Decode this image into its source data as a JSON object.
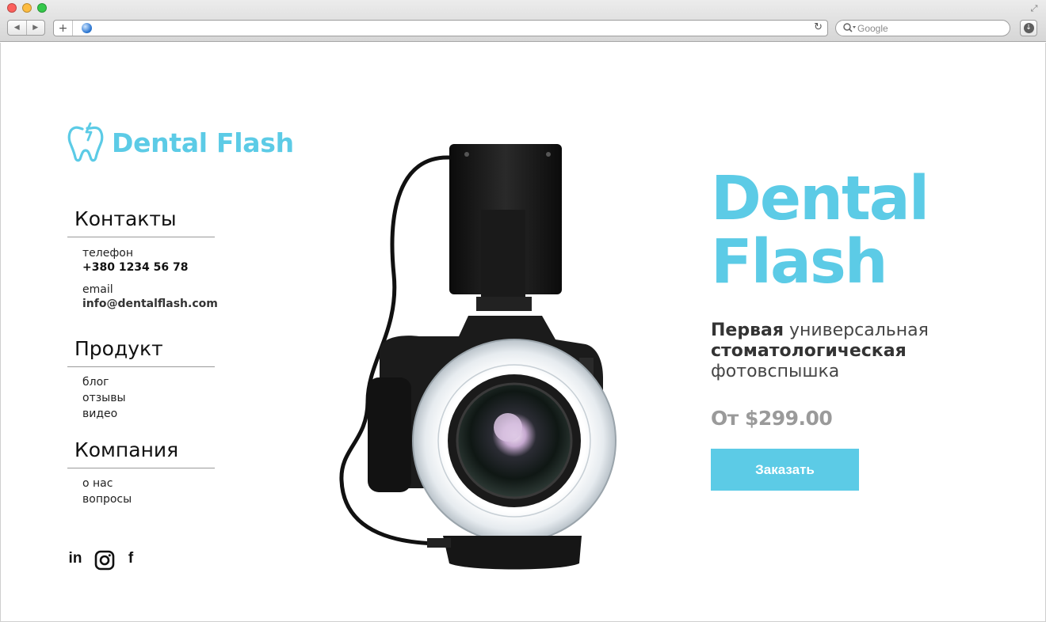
{
  "browser": {
    "search_placeholder": "Google",
    "icons": [
      "back-icon",
      "forward-icon",
      "new-tab-icon",
      "globe-icon",
      "reload-icon",
      "search-icon",
      "download-icon",
      "fullscreen-icon"
    ]
  },
  "brand": {
    "logo_text": "Dental Flash",
    "accent_color": "#5ccbe6"
  },
  "sidebar": {
    "contacts": {
      "title": "Контакты",
      "phone_label": "телефон",
      "phone_value": "+380 1234 56 78",
      "email_label": "email",
      "email_value": "info@dentalflash.com"
    },
    "product": {
      "title": "Продукт",
      "links": [
        "блог",
        "отзывы",
        "видео"
      ]
    },
    "company": {
      "title": "Компания",
      "links": [
        "о нас",
        "вопросы"
      ]
    },
    "social": {
      "linkedin": "in",
      "facebook": "f"
    }
  },
  "hero": {
    "title_line1": "Dental",
    "title_line2": "Flash",
    "subtitle_bold1": "Первая",
    "subtitle_rest1": " универсальная",
    "subtitle_bold2": "стоматологическая",
    "subtitle_line3": "фотовспышка",
    "price": "От $299.00",
    "cta_label": "Заказать"
  }
}
